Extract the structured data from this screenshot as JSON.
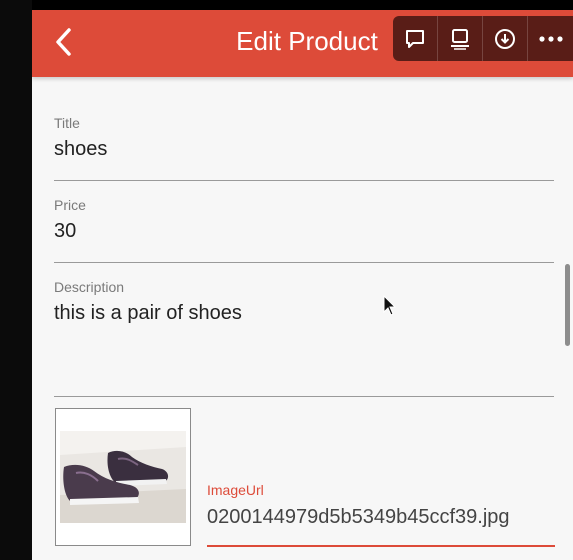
{
  "appbar": {
    "title": "Edit Product",
    "back_icon": "chevron-left-icon",
    "color": "#dd4b39"
  },
  "toolbar": {
    "icons": [
      "comment-icon",
      "subtitles-icon",
      "download-icon",
      "more-icon"
    ]
  },
  "form": {
    "title": {
      "label": "Title",
      "value": "shoes"
    },
    "price": {
      "label": "Price",
      "value": "30"
    },
    "description": {
      "label": "Description",
      "value": "this is a pair of shoes"
    },
    "image_url": {
      "label": "ImageUrl",
      "value": "0200144979d5b5349b45ccf39.jpg"
    }
  },
  "accent_color": "#dd4b39"
}
